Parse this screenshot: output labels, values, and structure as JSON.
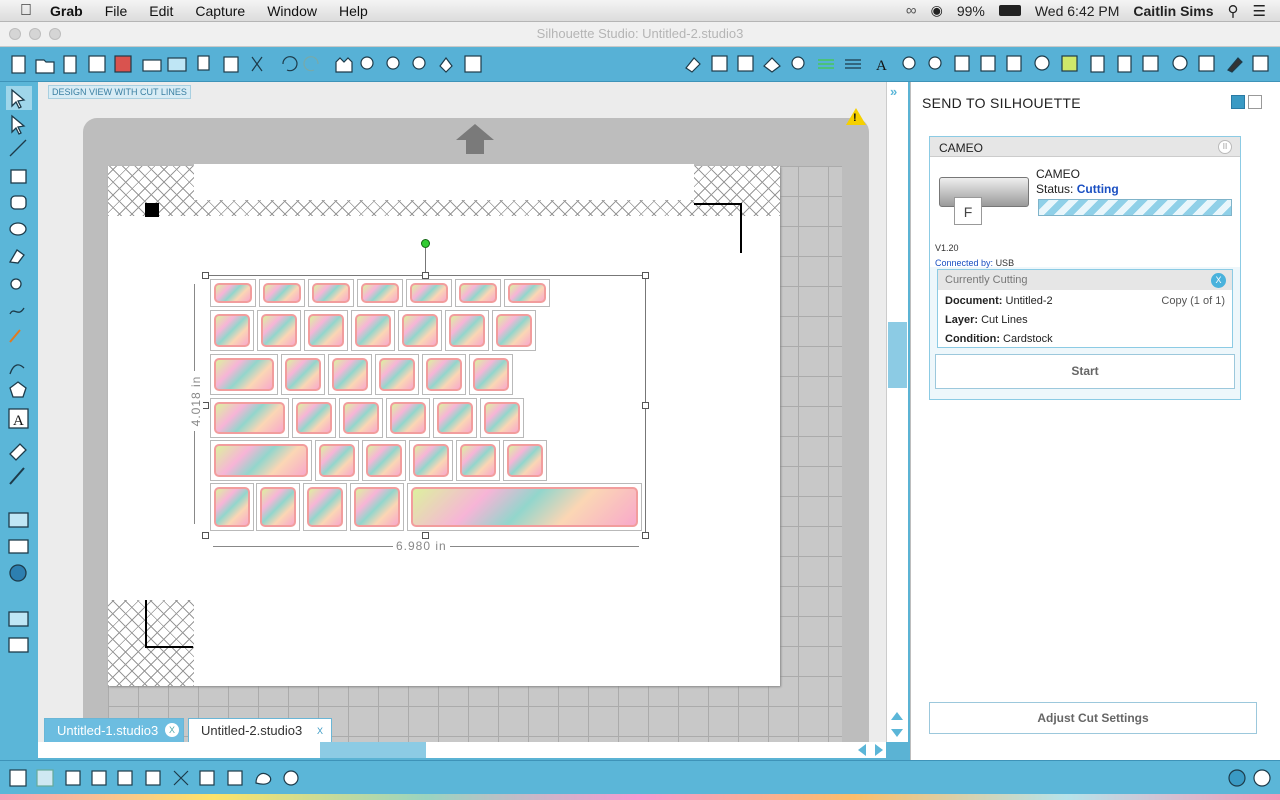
{
  "menubar": {
    "app": "Grab",
    "items": [
      "File",
      "Edit",
      "Capture",
      "Window",
      "Help"
    ],
    "battery": "99%",
    "clock": "Wed 6:42 PM",
    "user": "Caitlin Sims"
  },
  "window": {
    "title": "Silhouette Studio: Untitled-2.studio3"
  },
  "canvas": {
    "view_label": "DESIGN VIEW WITH CUT LINES",
    "width_dim": "6.980 in",
    "height_dim": "4.018 in"
  },
  "tabs": [
    {
      "label": "Untitled-1.studio3",
      "close": "X",
      "active": false
    },
    {
      "label": "Untitled-2.studio3",
      "close": "X",
      "active": true
    }
  ],
  "panel": {
    "title": "SEND TO SILHOUETTE",
    "device_header": "CAMEO",
    "device_name": "CAMEO",
    "status_label": "Status:",
    "status_value": "Cutting",
    "progress": 1.0,
    "version": "V1.20",
    "connected_label": "Connected by:",
    "connected_value": "USB",
    "current": {
      "header": "Currently Cutting",
      "close": "X",
      "document_label": "Document:",
      "document_value": "Untitled-2",
      "copy": "Copy (1 of 1)",
      "layer_label": "Layer:",
      "layer_value": "Cut Lines",
      "condition_label": "Condition:",
      "condition_value": "Cardstock"
    },
    "start_button": "Start",
    "adjust_button": "Adjust Cut Settings"
  },
  "colors": {
    "accent": "#57b1d6",
    "status": "#1a4fc2",
    "cut": "#f08c8c"
  }
}
